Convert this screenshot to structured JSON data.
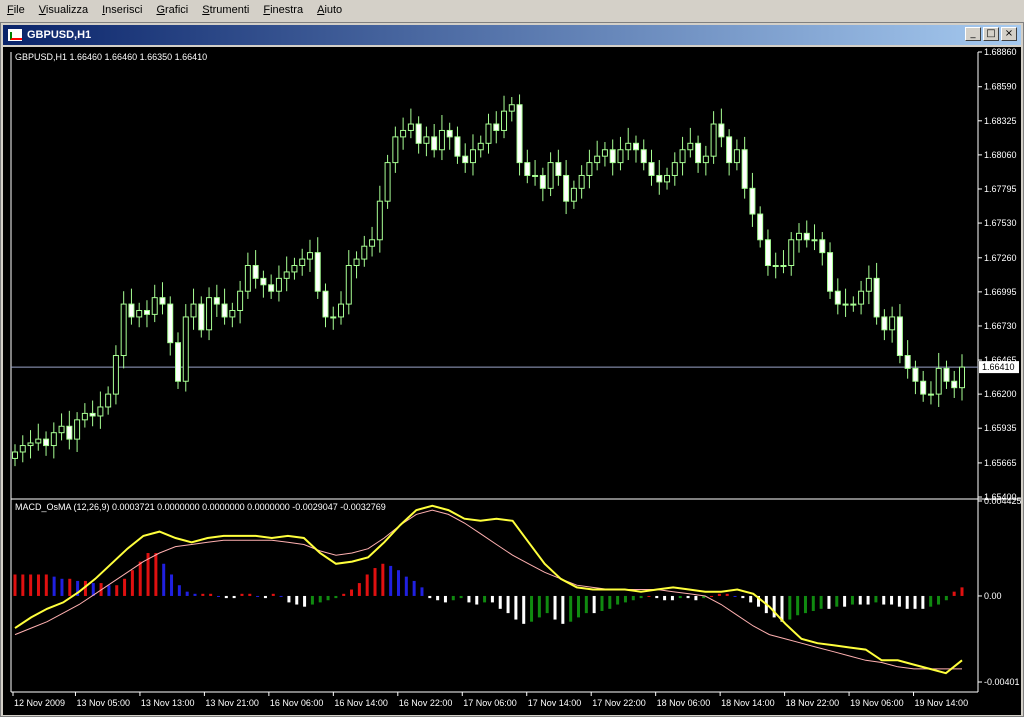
{
  "menu": [
    "File",
    "Visualizza",
    "Inserisci",
    "Grafici",
    "Strumenti",
    "Finestra",
    "Aiuto"
  ],
  "window": {
    "title": "GBPUSD,H1",
    "minimize": "_",
    "restore": "□",
    "close": "×"
  },
  "colors": {
    "background": "#000000",
    "candle": "#a8ff94",
    "axis": "#ffffff",
    "bid_line": "#9aa4c8",
    "macd_line": "#ffff3c",
    "signal_line": "#ffb0b0",
    "hist_red": "#e01010",
    "hist_blue": "#2020e0",
    "hist_white": "#ffffff",
    "hist_green": "#108a10"
  },
  "price_panel": {
    "header": "GBPUSD,H1  1.66460 1.66460 1.66350 1.66410",
    "current_price": "1.66410",
    "price_labels": [
      "1.68860",
      "1.68590",
      "1.68325",
      "1.68060",
      "1.67795",
      "1.67530",
      "1.67260",
      "1.66995",
      "1.66730",
      "1.66465",
      "1.66200",
      "1.65935",
      "1.65665",
      "1.65400"
    ]
  },
  "indicator_panel": {
    "header": "MACD_OsMA (12,26,9) 0.0003721 0.0000000 0.0000000 0.0000000 -0.0029047 -0.0032769",
    "labels": [
      "0.004425",
      "0.00",
      "-0.00401"
    ]
  },
  "time_labels": [
    "12 Nov 2009",
    "13 Nov 05:00",
    "13 Nov 13:00",
    "13 Nov 21:00",
    "16 Nov 06:00",
    "16 Nov 14:00",
    "16 Nov 22:00",
    "17 Nov 06:00",
    "17 Nov 14:00",
    "17 Nov 22:00",
    "18 Nov 06:00",
    "18 Nov 14:00",
    "18 Nov 22:00",
    "19 Nov 06:00",
    "19 Nov 14:00"
  ],
  "chart_data": {
    "type": "candlestick",
    "price_ylim": [
      1.654,
      1.6886
    ],
    "price_series": [
      1.6575,
      1.658,
      1.6582,
      1.6585,
      1.658,
      1.659,
      1.6595,
      1.6585,
      1.66,
      1.6605,
      1.6603,
      1.661,
      1.662,
      1.665,
      1.669,
      1.668,
      1.6685,
      1.6682,
      1.6695,
      1.669,
      1.666,
      1.663,
      1.668,
      1.669,
      1.667,
      1.6695,
      1.669,
      1.668,
      1.6685,
      1.67,
      1.672,
      1.671,
      1.6705,
      1.67,
      1.671,
      1.6715,
      1.672,
      1.6725,
      1.673,
      1.67,
      1.668,
      1.668,
      1.669,
      1.672,
      1.6725,
      1.6735,
      1.674,
      1.677,
      1.68,
      1.682,
      1.6825,
      1.683,
      1.6815,
      1.682,
      1.681,
      1.6825,
      1.682,
      1.6805,
      1.68,
      1.681,
      1.6815,
      1.683,
      1.6825,
      1.684,
      1.6845,
      1.68,
      1.679,
      1.679,
      1.678,
      1.68,
      1.679,
      1.677,
      1.678,
      1.679,
      1.68,
      1.6805,
      1.681,
      1.68,
      1.681,
      1.6815,
      1.681,
      1.68,
      1.679,
      1.6785,
      1.679,
      1.68,
      1.681,
      1.6815,
      1.68,
      1.6805,
      1.683,
      1.682,
      1.68,
      1.681,
      1.678,
      1.676,
      1.674,
      1.672,
      1.672,
      1.672,
      1.674,
      1.6745,
      1.674,
      1.674,
      1.673,
      1.67,
      1.669,
      1.669,
      1.669,
      1.67,
      1.671,
      1.668,
      1.667,
      1.668,
      1.665,
      1.664,
      1.663,
      1.662,
      1.662,
      1.664,
      1.663,
      1.6625,
      1.6641
    ],
    "macd_ylim": [
      -0.00401,
      0.004425
    ],
    "macd_series": [
      -0.0015,
      -0.001,
      -0.0006,
      -0.0003,
      0.0002,
      0.0008,
      0.0015,
      0.0022,
      0.0028,
      0.003,
      0.0027,
      0.0025,
      0.0027,
      0.0028,
      0.0028,
      0.0028,
      0.0027,
      0.0028,
      0.0027,
      0.002,
      0.0015,
      0.0016,
      0.0018,
      0.0025,
      0.0033,
      0.004,
      0.0042,
      0.004,
      0.0036,
      0.0035,
      0.0036,
      0.0035,
      0.0025,
      0.0015,
      0.0008,
      0.0004,
      0.0003,
      0.0003,
      0.0003,
      0.0002,
      0.0003,
      0.0004,
      0.0003,
      0.0002,
      0.0002,
      0.0003,
      0.0001,
      -0.0005,
      -0.0013,
      -0.002,
      -0.0022,
      -0.0023,
      -0.0024,
      -0.0025,
      -0.003,
      -0.003,
      -0.0032,
      -0.0034,
      -0.0036,
      -0.003
    ],
    "signal_series": [
      -0.0018,
      -0.0015,
      -0.0012,
      -0.0008,
      -0.0004,
      0.0001,
      0.0006,
      0.0011,
      0.0016,
      0.002,
      0.0023,
      0.0024,
      0.0025,
      0.0026,
      0.0026,
      0.0026,
      0.0026,
      0.0025,
      0.0024,
      0.0021,
      0.0019,
      0.002,
      0.0022,
      0.0027,
      0.0033,
      0.0038,
      0.004,
      0.0038,
      0.0034,
      0.0029,
      0.0024,
      0.0019,
      0.0015,
      0.0011,
      0.0008,
      0.0005,
      0.0004,
      0.0003,
      0.0003,
      0.0003,
      0.0003,
      0.0002,
      0.0001,
      0.0,
      -0.0004,
      -0.0009,
      -0.0014,
      -0.0018,
      -0.002,
      -0.0022,
      -0.0024,
      -0.0026,
      -0.0028,
      -0.003,
      -0.0031,
      -0.0033,
      -0.0034,
      -0.0034,
      -0.0034,
      -0.0034
    ],
    "histogram": [
      0.001,
      0.001,
      0.001,
      0.001,
      0.001,
      0.0009,
      0.0008,
      0.0008,
      0.0007,
      0.0007,
      0.0006,
      0.0006,
      0.0005,
      0.0005,
      0.0008,
      0.0012,
      0.0016,
      0.002,
      0.002,
      0.0015,
      0.001,
      0.0005,
      0.0002,
      0.0001,
      0.0001,
      0.0001,
      0.0,
      -0.0001,
      -0.0001,
      0.0001,
      0.0001,
      0.0,
      -0.0001,
      0.0001,
      0.0,
      -0.0003,
      -0.0004,
      -0.0005,
      -0.0004,
      -0.0003,
      -0.0002,
      -0.0001,
      0.0001,
      0.0003,
      0.0006,
      0.001,
      0.0013,
      0.0015,
      0.0014,
      0.0012,
      0.0009,
      0.0007,
      0.0004,
      -0.0001,
      -0.0002,
      -0.0003,
      -0.0002,
      -0.0001,
      -0.0003,
      -0.0004,
      -0.0003,
      -0.0003,
      -0.0006,
      -0.0008,
      -0.0011,
      -0.0013,
      -0.0012,
      -0.001,
      -0.0008,
      -0.0011,
      -0.0013,
      -0.0012,
      -0.001,
      -0.0008,
      -0.0008,
      -0.0007,
      -0.0006,
      -0.0004,
      -0.0003,
      -0.0002,
      -0.0001,
      0.0,
      -0.0001,
      -0.0002,
      -0.0002,
      -0.0001,
      -0.0001,
      -0.0002,
      -0.0001,
      0.0,
      0.0001,
      0.0001,
      0.0,
      -0.0001,
      -0.0003,
      -0.0005,
      -0.0008,
      -0.001,
      -0.0012,
      -0.0011,
      -0.0009,
      -0.0008,
      -0.0007,
      -0.0006,
      -0.0006,
      -0.0005,
      -0.0005,
      -0.0004,
      -0.0004,
      -0.0004,
      -0.0003,
      -0.0004,
      -0.0004,
      -0.0005,
      -0.0006,
      -0.0006,
      -0.0006,
      -0.0005,
      -0.0004,
      -0.0002,
      0.0002,
      0.0004
    ]
  }
}
